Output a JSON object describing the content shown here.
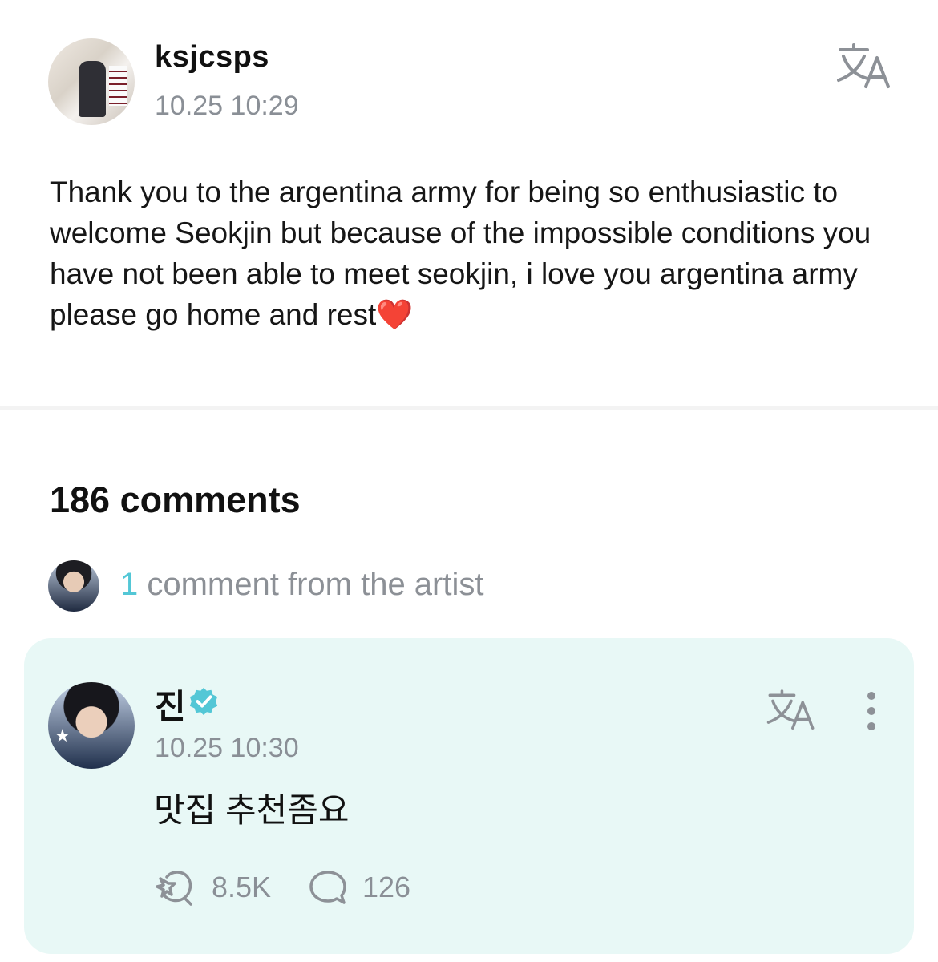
{
  "post": {
    "author": "ksjcsps",
    "timestamp": "10.25 10:29",
    "body": "Thank you to the argentina army for being so enthusiastic to welcome Seokjin but because of the impossible conditions you have not been able to meet seokjin, i love you argentina army please go home and rest❤️",
    "translate_icon": "translate-icon"
  },
  "comments": {
    "count_label": "186 comments",
    "artist_summary": {
      "count": "1",
      "label": " comment from the artist"
    }
  },
  "artist_comment": {
    "name": "진",
    "verified_icon": "verified-badge-icon",
    "timestamp": "10.25 10:30",
    "text": "맛집 추천좀요",
    "likes": "8.5K",
    "replies": "126",
    "accent_color": "#53c7d6",
    "card_color": "#e8f8f6"
  }
}
